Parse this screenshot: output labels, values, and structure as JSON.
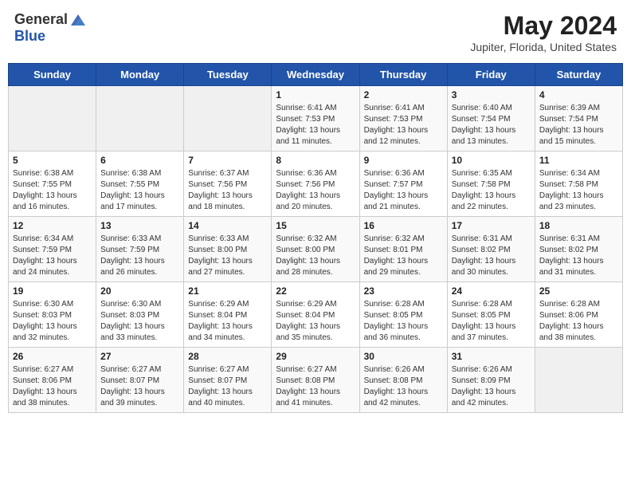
{
  "header": {
    "logo_general": "General",
    "logo_blue": "Blue",
    "title": "May 2024",
    "subtitle": "Jupiter, Florida, United States"
  },
  "days_of_week": [
    "Sunday",
    "Monday",
    "Tuesday",
    "Wednesday",
    "Thursday",
    "Friday",
    "Saturday"
  ],
  "weeks": [
    [
      {
        "day": "",
        "info": ""
      },
      {
        "day": "",
        "info": ""
      },
      {
        "day": "",
        "info": ""
      },
      {
        "day": "1",
        "info": "Sunrise: 6:41 AM\nSunset: 7:53 PM\nDaylight: 13 hours\nand 11 minutes."
      },
      {
        "day": "2",
        "info": "Sunrise: 6:41 AM\nSunset: 7:53 PM\nDaylight: 13 hours\nand 12 minutes."
      },
      {
        "day": "3",
        "info": "Sunrise: 6:40 AM\nSunset: 7:54 PM\nDaylight: 13 hours\nand 13 minutes."
      },
      {
        "day": "4",
        "info": "Sunrise: 6:39 AM\nSunset: 7:54 PM\nDaylight: 13 hours\nand 15 minutes."
      }
    ],
    [
      {
        "day": "5",
        "info": "Sunrise: 6:38 AM\nSunset: 7:55 PM\nDaylight: 13 hours\nand 16 minutes."
      },
      {
        "day": "6",
        "info": "Sunrise: 6:38 AM\nSunset: 7:55 PM\nDaylight: 13 hours\nand 17 minutes."
      },
      {
        "day": "7",
        "info": "Sunrise: 6:37 AM\nSunset: 7:56 PM\nDaylight: 13 hours\nand 18 minutes."
      },
      {
        "day": "8",
        "info": "Sunrise: 6:36 AM\nSunset: 7:56 PM\nDaylight: 13 hours\nand 20 minutes."
      },
      {
        "day": "9",
        "info": "Sunrise: 6:36 AM\nSunset: 7:57 PM\nDaylight: 13 hours\nand 21 minutes."
      },
      {
        "day": "10",
        "info": "Sunrise: 6:35 AM\nSunset: 7:58 PM\nDaylight: 13 hours\nand 22 minutes."
      },
      {
        "day": "11",
        "info": "Sunrise: 6:34 AM\nSunset: 7:58 PM\nDaylight: 13 hours\nand 23 minutes."
      }
    ],
    [
      {
        "day": "12",
        "info": "Sunrise: 6:34 AM\nSunset: 7:59 PM\nDaylight: 13 hours\nand 24 minutes."
      },
      {
        "day": "13",
        "info": "Sunrise: 6:33 AM\nSunset: 7:59 PM\nDaylight: 13 hours\nand 26 minutes."
      },
      {
        "day": "14",
        "info": "Sunrise: 6:33 AM\nSunset: 8:00 PM\nDaylight: 13 hours\nand 27 minutes."
      },
      {
        "day": "15",
        "info": "Sunrise: 6:32 AM\nSunset: 8:00 PM\nDaylight: 13 hours\nand 28 minutes."
      },
      {
        "day": "16",
        "info": "Sunrise: 6:32 AM\nSunset: 8:01 PM\nDaylight: 13 hours\nand 29 minutes."
      },
      {
        "day": "17",
        "info": "Sunrise: 6:31 AM\nSunset: 8:02 PM\nDaylight: 13 hours\nand 30 minutes."
      },
      {
        "day": "18",
        "info": "Sunrise: 6:31 AM\nSunset: 8:02 PM\nDaylight: 13 hours\nand 31 minutes."
      }
    ],
    [
      {
        "day": "19",
        "info": "Sunrise: 6:30 AM\nSunset: 8:03 PM\nDaylight: 13 hours\nand 32 minutes."
      },
      {
        "day": "20",
        "info": "Sunrise: 6:30 AM\nSunset: 8:03 PM\nDaylight: 13 hours\nand 33 minutes."
      },
      {
        "day": "21",
        "info": "Sunrise: 6:29 AM\nSunset: 8:04 PM\nDaylight: 13 hours\nand 34 minutes."
      },
      {
        "day": "22",
        "info": "Sunrise: 6:29 AM\nSunset: 8:04 PM\nDaylight: 13 hours\nand 35 minutes."
      },
      {
        "day": "23",
        "info": "Sunrise: 6:28 AM\nSunset: 8:05 PM\nDaylight: 13 hours\nand 36 minutes."
      },
      {
        "day": "24",
        "info": "Sunrise: 6:28 AM\nSunset: 8:05 PM\nDaylight: 13 hours\nand 37 minutes."
      },
      {
        "day": "25",
        "info": "Sunrise: 6:28 AM\nSunset: 8:06 PM\nDaylight: 13 hours\nand 38 minutes."
      }
    ],
    [
      {
        "day": "26",
        "info": "Sunrise: 6:27 AM\nSunset: 8:06 PM\nDaylight: 13 hours\nand 38 minutes."
      },
      {
        "day": "27",
        "info": "Sunrise: 6:27 AM\nSunset: 8:07 PM\nDaylight: 13 hours\nand 39 minutes."
      },
      {
        "day": "28",
        "info": "Sunrise: 6:27 AM\nSunset: 8:07 PM\nDaylight: 13 hours\nand 40 minutes."
      },
      {
        "day": "29",
        "info": "Sunrise: 6:27 AM\nSunset: 8:08 PM\nDaylight: 13 hours\nand 41 minutes."
      },
      {
        "day": "30",
        "info": "Sunrise: 6:26 AM\nSunset: 8:08 PM\nDaylight: 13 hours\nand 42 minutes."
      },
      {
        "day": "31",
        "info": "Sunrise: 6:26 AM\nSunset: 8:09 PM\nDaylight: 13 hours\nand 42 minutes."
      },
      {
        "day": "",
        "info": ""
      }
    ]
  ]
}
